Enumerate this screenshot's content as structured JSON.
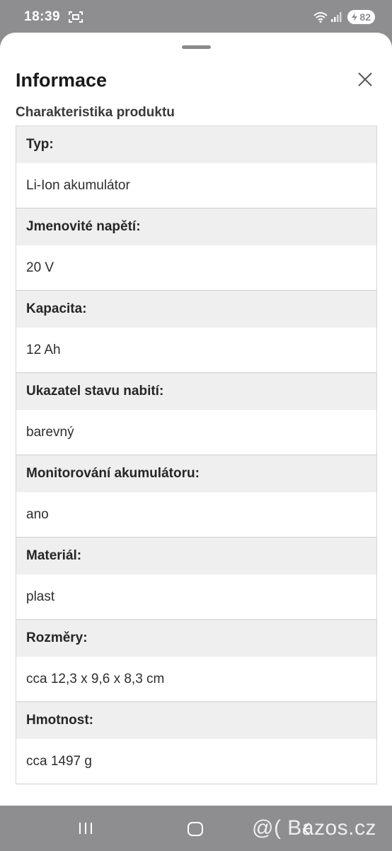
{
  "status_bar": {
    "time": "18:39",
    "battery": "82"
  },
  "sheet": {
    "title": "Informace",
    "section_title": "Charakteristika produktu",
    "specs": [
      {
        "label": "Typ:",
        "value": "Li-Ion akumulátor"
      },
      {
        "label": "Jmenovité napětí:",
        "value": "20 V"
      },
      {
        "label": "Kapacita:",
        "value": "12 Ah"
      },
      {
        "label": "Ukazatel stavu nabití:",
        "value": "barevný"
      },
      {
        "label": "Monitorování akumulátoru:",
        "value": "ano"
      },
      {
        "label": "Materiál:",
        "value": "plast"
      },
      {
        "label": "Rozměry:",
        "value": "cca 12,3 x 9,6 x 8,3 cm"
      },
      {
        "label": "Hmotnost:",
        "value": "cca 1497 g"
      }
    ]
  },
  "watermark": "@( Bazos.cz",
  "icons": {
    "close": "close-icon",
    "screenshot": "screenshot-icon",
    "wifi": "wifi-icon",
    "signal": "signal-icon",
    "recents": "recents-icon",
    "home": "home-icon",
    "back": "back-icon"
  },
  "colors": {
    "backdrop": "#8e8e90",
    "sheet": "#ffffff",
    "label_bg": "#efefef"
  }
}
